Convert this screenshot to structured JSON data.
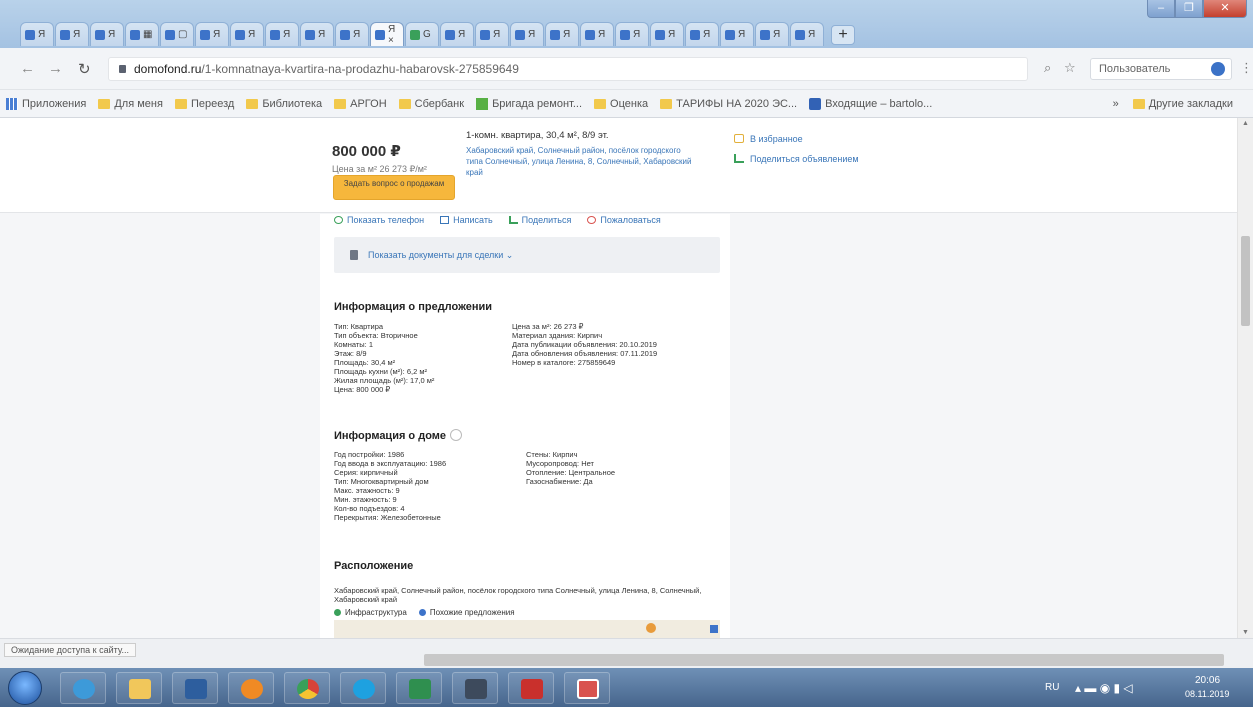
{
  "browser": {
    "tabs": [
      {
        "label": "Я",
        "icon": "yandex-tab-icon"
      },
      {
        "label": "Я",
        "icon": "yandex-tab-icon"
      },
      {
        "label": "Я",
        "icon": "yandex-tab-icon"
      },
      {
        "label": "▦",
        "icon": "grid-tab-icon"
      },
      {
        "label": "▢",
        "icon": "page-tab-icon"
      },
      {
        "label": "Я",
        "icon": "yandex-tab-icon"
      },
      {
        "label": "Я",
        "icon": "yandex-tab-icon"
      },
      {
        "label": "Я",
        "icon": "yandex-tab-icon"
      },
      {
        "label": "Я",
        "icon": "yandex-tab-icon"
      },
      {
        "label": "Я",
        "icon": "yandex-tab-icon"
      },
      {
        "label": "Я ×",
        "icon": "yandex-tab-icon",
        "active": true
      },
      {
        "label": "G",
        "icon": "google-tab-icon"
      },
      {
        "label": "Я",
        "icon": "yandex-tab-icon"
      },
      {
        "label": "Я",
        "icon": "yandex-tab-icon"
      },
      {
        "label": "Я",
        "icon": "yandex-tab-icon"
      },
      {
        "label": "Я",
        "icon": "yandex-tab-icon"
      },
      {
        "label": "Я",
        "icon": "yandex-tab-icon"
      },
      {
        "label": "Я",
        "icon": "yandex-tab-icon"
      },
      {
        "label": "Я",
        "icon": "yandex-tab-icon"
      },
      {
        "label": "Я",
        "icon": "yandex-tab-icon"
      },
      {
        "label": "Я",
        "icon": "yandex-tab-icon"
      },
      {
        "label": "Я",
        "icon": "yandex-tab-icon"
      },
      {
        "label": "Я",
        "icon": "yandex-tab-icon"
      }
    ],
    "new_tab": "+",
    "address": {
      "domain": "domofond.ru",
      "path": "/1-komnatnaya-kvartira-na-prodazhu-habarovsk-275859649"
    },
    "signin_label": "Пользователь",
    "bookmarks": [
      {
        "label": "Приложения",
        "icon": "apps-grid-icon"
      },
      {
        "label": "Для меня",
        "icon": "folder-icon"
      },
      {
        "label": "Переезд",
        "icon": "folder-icon"
      },
      {
        "label": "Библиотека",
        "icon": "folder-icon"
      },
      {
        "label": "АРГОН",
        "icon": "folder-icon"
      },
      {
        "label": "Сбербанк",
        "icon": "folder-icon"
      },
      {
        "label": "Бригада ремонт...",
        "icon": "building-icon"
      },
      {
        "label": "Оценка",
        "icon": "folder-icon"
      },
      {
        "label": "ТАРИФЫ НА 2020 ЭС...",
        "icon": "folder-icon"
      },
      {
        "label": "Входящие – bartolo...",
        "icon": "mail-icon"
      }
    ],
    "bookmarks_more": "»",
    "bookmarks_other": "Другие закладки",
    "status_text": "Ожидание доступа к сайту..."
  },
  "listing": {
    "price": "800 000 ₽",
    "price_per_m2": "Цена за м² 26 273 ₽/м²",
    "ask_button": "Задать вопрос о продажам",
    "title": "1-комн. квартира, 30,4 м², 8/9 эт.",
    "address": "Хабаровский край, Солнечный район, посёлок городского типа Солнечный, улица Ленина, 8, Солнечный, Хабаровский край",
    "favorite": "В избранное",
    "share": "Поделиться объявлением",
    "actions": [
      "Показать телефон",
      "Написать",
      "Поделиться",
      "Пожаловаться"
    ],
    "details_dropdown": "Показать документы для сделки ⌄",
    "offer_section": "Информация о предложении",
    "offer_left": [
      "Тип: Квартира",
      "Тип объекта: Вторичное",
      "Комнаты: 1",
      "Этаж: 8/9",
      "Площадь: 30,4 м²",
      "Площадь кухни (м²): 6,2 м²",
      "Жилая площадь (м²): 17,0 м²",
      "Цена: 800 000 ₽"
    ],
    "offer_right": [
      "Цена за м²: 26 273 ₽",
      "Материал здания: Кирпич",
      "Дата публикации объявления: 20.10.2019",
      "Дата обновления объявления: 07.11.2019",
      "Номер в каталоге: 275859649"
    ],
    "house_section": "Информация о доме",
    "house_left": [
      "Год постройки: 1986",
      "Год ввода в эксплуатацию: 1986",
      "Серия: кирпичный",
      "Тип: Многоквартирный дом",
      "Макс. этажность: 9",
      "Мин. этажность: 9",
      "Кол-во подъездов: 4",
      "Перекрытия: Железобетонные"
    ],
    "house_right": [
      "Стены: Кирпич",
      "Мусоропровод: Нет",
      "Отопление: Центральное",
      "Газоснабжение: Да"
    ],
    "location_section": "Расположение",
    "location_text": "Хабаровский край, Солнечный район, посёлок городского типа Солнечный, улица Ленина, 8, Солнечный, Хабаровский край",
    "map_options": [
      "Инфраструктура",
      "Похожие предложения"
    ]
  },
  "taskbar": {
    "time": "20:06",
    "date": "08.11.2019",
    "lang": "RU"
  }
}
